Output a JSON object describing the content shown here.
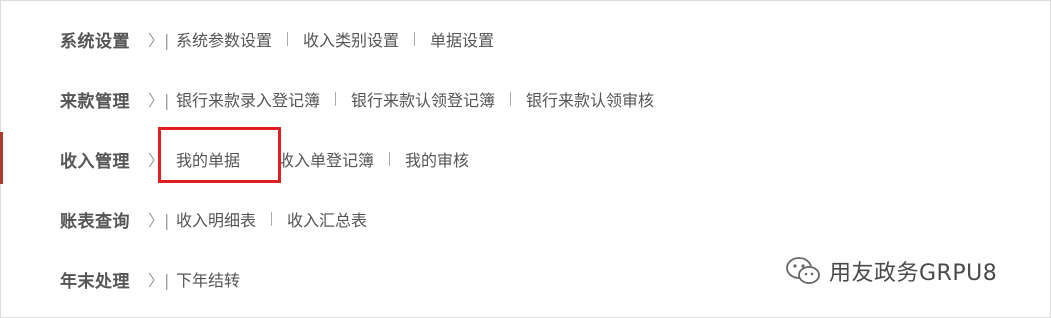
{
  "menu": {
    "rows": [
      {
        "category": "系统设置",
        "arrow": "〉|",
        "items": [
          "系统参数设置",
          "收入类别设置",
          "单据设置"
        ]
      },
      {
        "category": "来款管理",
        "arrow": "〉|",
        "items": [
          "银行来款录入登记簿",
          "银行来款认领登记簿",
          "银行来款认领审核"
        ]
      },
      {
        "category": "收入管理",
        "arrow": "〉",
        "items": [
          "我的单据",
          "收入单登记簿",
          "我的审核"
        ]
      },
      {
        "category": "账表查询",
        "arrow": "〉|",
        "items": [
          "收入明细表",
          "收入汇总表"
        ]
      },
      {
        "category": "年末处理",
        "arrow": "〉|",
        "items": [
          "下年结转"
        ]
      }
    ]
  },
  "watermark": {
    "text": "用友政务GRPU8",
    "icon": "wechat-icon"
  },
  "colors": {
    "accent": "#b03a2e",
    "highlight_border": "#e02020",
    "text": "#555555"
  }
}
